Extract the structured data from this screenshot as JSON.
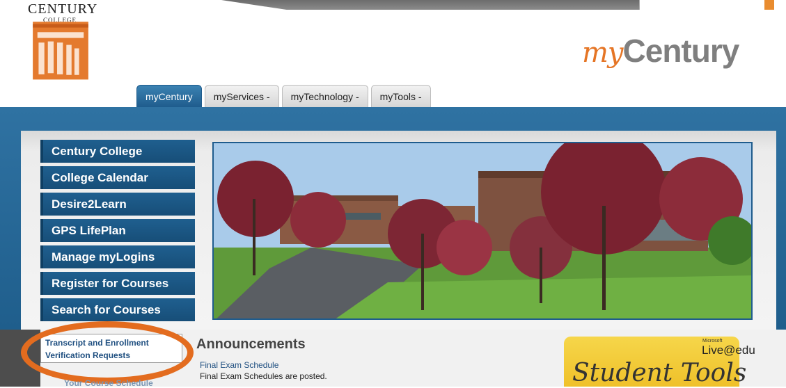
{
  "header": {
    "logo_title": "CENTURY",
    "logo_subtitle": "COLLEGE",
    "brand_prefix": "my",
    "brand_name": "Century"
  },
  "tabs": [
    {
      "label": "myCentury",
      "active": true
    },
    {
      "label": "myServices -",
      "active": false
    },
    {
      "label": "myTechnology -",
      "active": false
    },
    {
      "label": "myTools -",
      "active": false
    }
  ],
  "sidebar": {
    "items": [
      {
        "label": "Century College"
      },
      {
        "label": "College Calendar"
      },
      {
        "label": "Desire2Learn"
      },
      {
        "label": "GPS LifePlan"
      },
      {
        "label": "Manage myLogins"
      },
      {
        "label": "Register for Courses"
      },
      {
        "label": "Search for Courses"
      }
    ]
  },
  "highlight_link": {
    "line1": "Transcript and Enrollment",
    "line2": "Verification Requests",
    "below_partial": "Your Course Schedule"
  },
  "announcements": {
    "title": "Announcements",
    "items": [
      {
        "link": "Final Exam Schedule",
        "desc": "Final Exam Schedules are posted."
      }
    ]
  },
  "ad": {
    "ms_label": "Microsoft",
    "live_label": "Live@edu",
    "title": "Student Tools"
  },
  "colors": {
    "brand_blue": "#1f5c8d",
    "highlight_orange": "#e36c1f",
    "brand_gray": "#7f7f7f"
  }
}
